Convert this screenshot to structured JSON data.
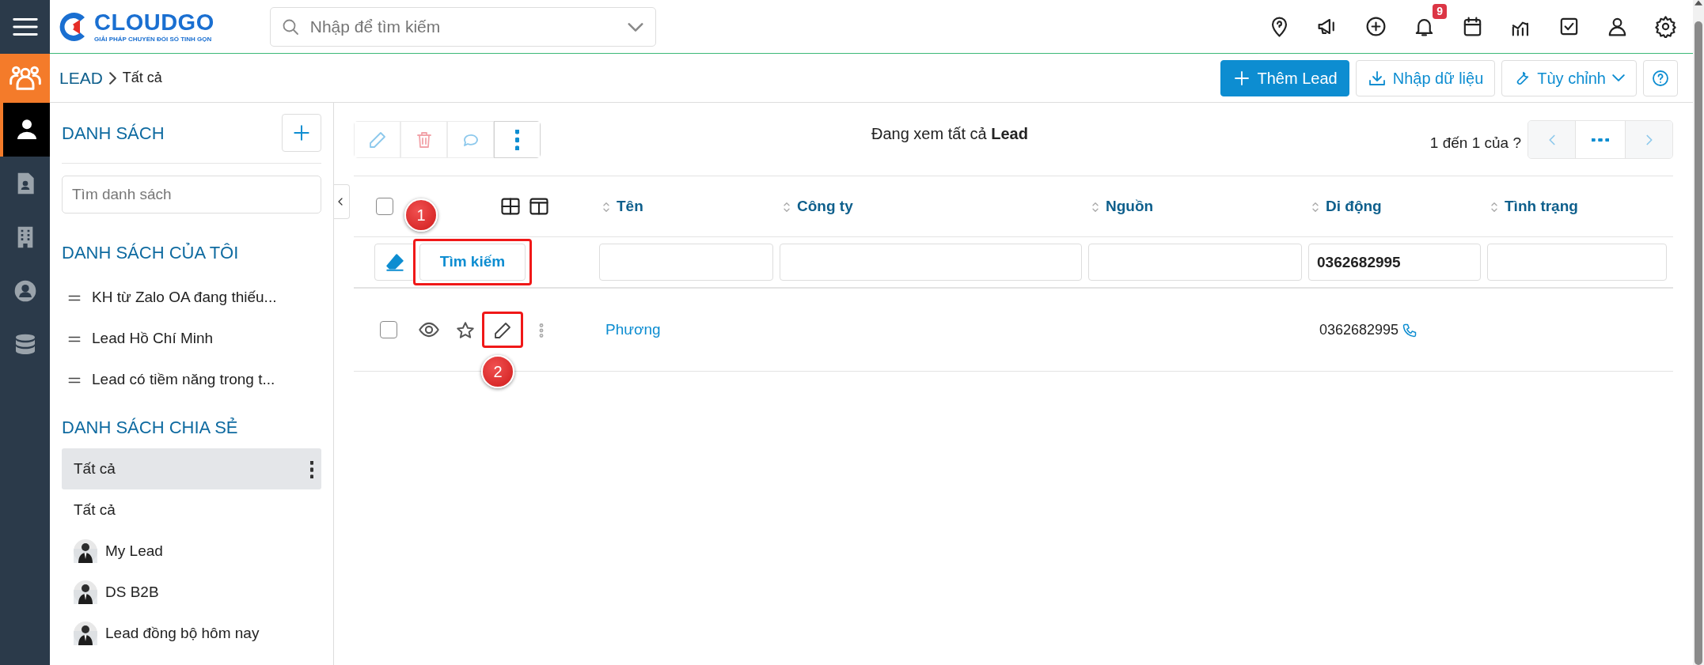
{
  "app": {
    "logo_name": "CLOUDGO",
    "logo_tagline": "GIẢI PHÁP CHUYỂN ĐỔI SỐ TINH GỌN"
  },
  "search": {
    "placeholder": "Nhập để tìm kiếm"
  },
  "notifications": {
    "badge": "9"
  },
  "rail": [
    {
      "selected": true
    },
    {
      "selected": false
    },
    {
      "selected": false
    },
    {
      "selected": false
    },
    {
      "selected": false
    }
  ],
  "breadcrumb": {
    "module": "LEAD",
    "current": "Tất cả"
  },
  "actions": [
    {
      "kind": "primary",
      "label": "Thêm Lead"
    },
    {
      "kind": "import",
      "label": "Nhập dữ liệu"
    },
    {
      "kind": "dropdown",
      "label": "Tùy chỉnh"
    },
    {
      "kind": "help"
    }
  ],
  "sidebar": {
    "title": "DANH SÁCH",
    "search_placeholder": "Tìm danh sách",
    "my_lists_title": "DANH SÁCH CỦA TÔI",
    "my_lists": [
      {
        "label": "KH từ Zalo OA đang thiếu..."
      },
      {
        "label": "Lead Hồ Chí Minh"
      },
      {
        "label": "Lead có tiềm năng trong t..."
      }
    ],
    "shared_title": "DANH SÁCH CHIA SẺ",
    "shared_lists": [
      {
        "kind": "plain",
        "label": "Tất cả",
        "selected": true
      },
      {
        "kind": "plain",
        "label": "Tất cả",
        "selected": false
      },
      {
        "kind": "avatar",
        "label": "My Lead",
        "selected": false
      },
      {
        "kind": "avatar",
        "label": "DS B2B",
        "selected": false
      },
      {
        "kind": "avatar",
        "label": "Lead đồng bộ hôm nay",
        "selected": false
      }
    ]
  },
  "toolbar": {
    "buttons": [
      {
        "disabled": true
      },
      {
        "disabled": true
      },
      {
        "disabled": true
      },
      {
        "disabled": false
      }
    ],
    "view_text": "Đang xem tất cả **Lead**",
    "pager_text": "1 đến 1 của ?"
  },
  "table": {
    "all_checked": false,
    "columns": [
      {
        "label": "Tên"
      },
      {
        "label": "Công ty"
      },
      {
        "label": "Nguồn"
      },
      {
        "label": "Di động",
        "filter": "0362682995"
      },
      {
        "label": "Tình trạng"
      }
    ],
    "search_button": "Tìm kiếm",
    "rows": [
      {
        "checked": false,
        "starred": false,
        "name": "Phương",
        "phone": "0362682995"
      }
    ]
  },
  "annotations": [
    {
      "label": "1"
    },
    {
      "label": "2"
    }
  ]
}
